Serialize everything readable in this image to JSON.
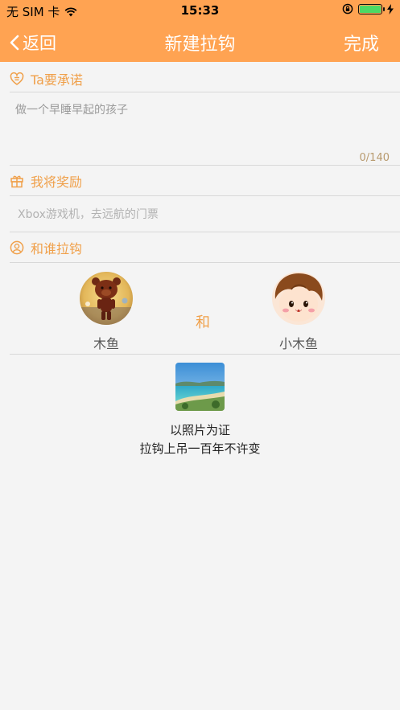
{
  "status_bar": {
    "carrier": "无 SIM 卡",
    "time": "15:33"
  },
  "nav": {
    "back_label": "返回",
    "title": "新建拉钩",
    "done_label": "完成"
  },
  "promise": {
    "heading": "Ta要承诺",
    "text": "做一个早睡早起的孩子",
    "counter": "0/140"
  },
  "reward": {
    "heading": "我将奖励",
    "placeholder": "Xbox游戏机，去远航的门票"
  },
  "partners": {
    "heading": "和谁拉钩",
    "left_name": "木鱼",
    "connector": "和",
    "right_name": "小木鱼"
  },
  "proof": {
    "caption_line1": "以照片为证",
    "caption_line2": "拉钩上吊一百年不许变"
  },
  "colors": {
    "accent": "#ffa352",
    "section_text": "#f0a04a",
    "background": "#f4f4f4"
  }
}
